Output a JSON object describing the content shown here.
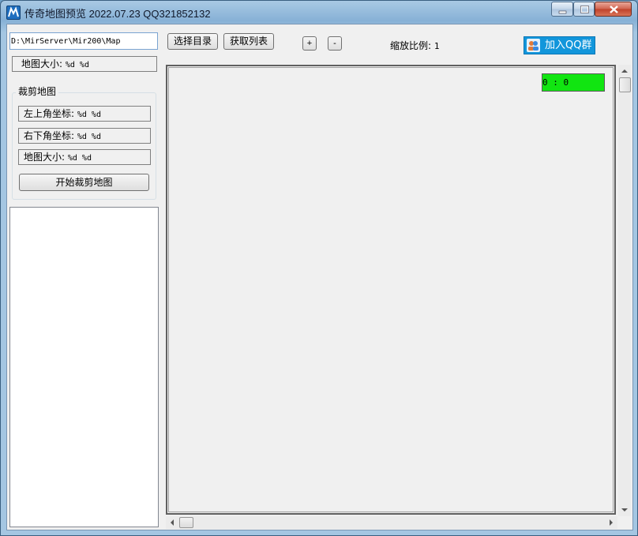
{
  "window": {
    "title": "传奇地图预览 2022.07.23 QQ321852132"
  },
  "toolbar": {
    "path_value": "D:\\MirServer\\Mir200\\Map",
    "select_dir_label": "选择目录",
    "get_list_label": "获取列表",
    "zoom_in_label": "+",
    "zoom_out_label": "-",
    "zoom_scale_label": "缩放比例:",
    "zoom_scale_value": "1",
    "join_qq_label": "加入QQ群"
  },
  "map_info": {
    "size_label": "地图大小:",
    "size_value": "%d  %d"
  },
  "crop": {
    "group_title": "裁剪地图",
    "top_left_label": "左上角坐标:",
    "top_left_value": "%d  %d",
    "bottom_right_label": "右下角坐标:",
    "bottom_right_value": "%d  %d",
    "size_label": "地图大小:",
    "size_value": "%d  %d",
    "start_button": "开始裁剪地图"
  },
  "canvas": {
    "coord_display": "0 : 0"
  },
  "colors": {
    "coord_bg": "#11e511",
    "qq_button": "#1296db"
  }
}
